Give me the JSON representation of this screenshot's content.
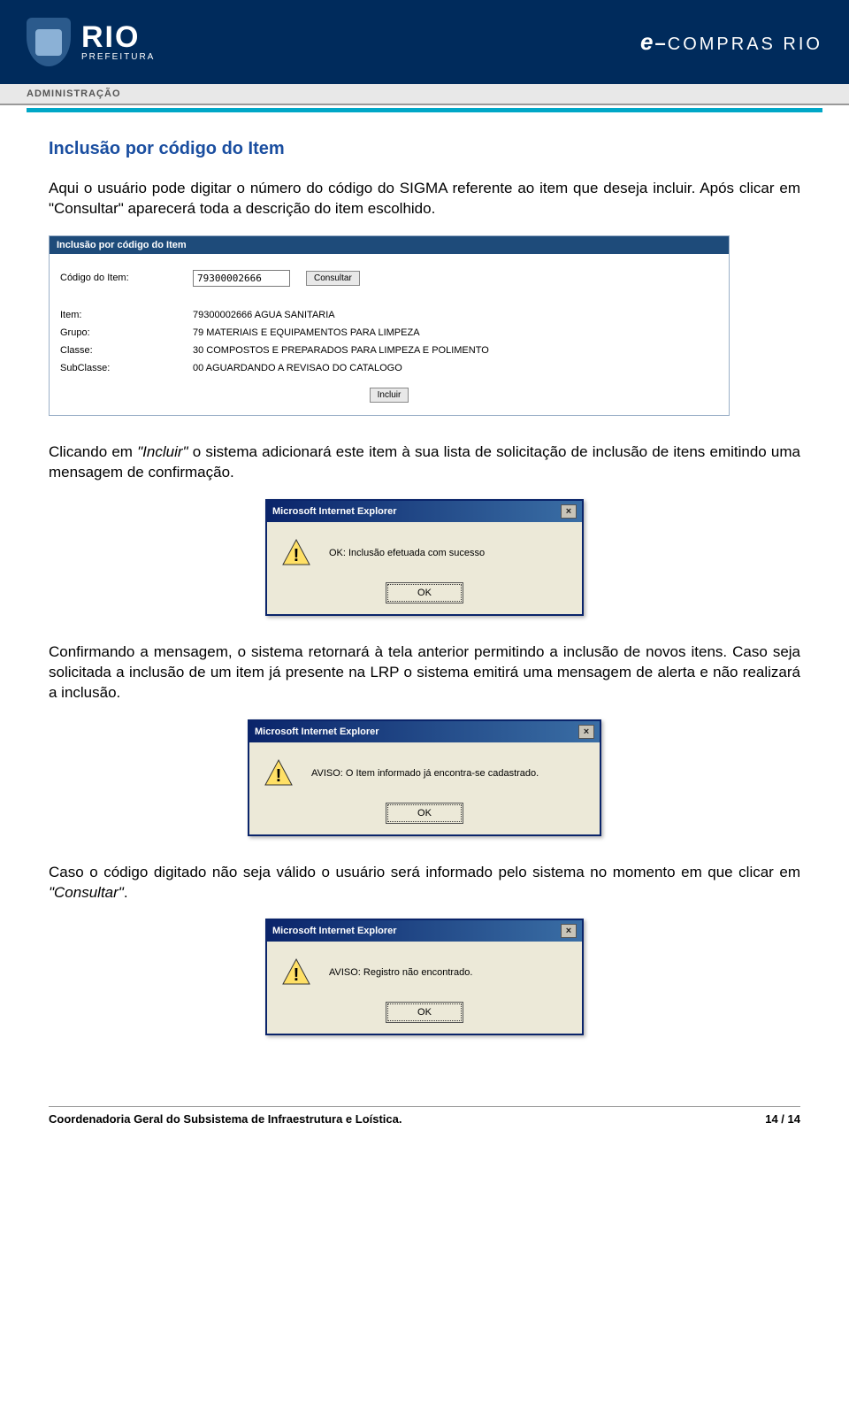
{
  "header": {
    "logo_main": "RIO",
    "logo_sub": "PREFEITURA",
    "right_e": "e",
    "right_dash": "–",
    "right_rest": "COMPRAS RIO"
  },
  "admin_bar": "ADMINISTRAÇÃO",
  "section_title": "Inclusão por código do Item",
  "para1": "Aqui o usuário pode digitar o número do código do SIGMA referente ao item que deseja incluir. Após clicar em \"Consultar\" aparecerá toda a descrição do item escolhido.",
  "form": {
    "title": "Inclusão por código do Item",
    "label_codigo": "Código do Item:",
    "codigo_value": "79300002666",
    "btn_consultar": "Consultar",
    "label_item": "Item:",
    "val_item": "79300002666 AGUA SANITARIA",
    "label_grupo": "Grupo:",
    "val_grupo": "79 MATERIAIS E EQUIPAMENTOS PARA LIMPEZA",
    "label_classe": "Classe:",
    "val_classe": "30 COMPOSTOS E PREPARADOS PARA LIMPEZA E POLIMENTO",
    "label_subclasse": "SubClasse:",
    "val_subclasse": "00 AGUARDANDO A REVISAO DO CATALOGO",
    "btn_incluir": "Incluir"
  },
  "para2_a": "Clicando em ",
  "para2_incluir": "\"Incluir\"",
  "para2_b": " o sistema adicionará este item à sua lista de solicitação de inclusão de itens emitindo uma mensagem de confirmação.",
  "dialog1": {
    "title": "Microsoft Internet Explorer",
    "msg": "OK: Inclusão efetuada com sucesso",
    "ok": "OK"
  },
  "para3": "Confirmando a mensagem, o sistema retornará à tela anterior permitindo a inclusão de novos itens. Caso seja solicitada a inclusão de um item já presente na LRP o sistema emitirá uma mensagem de alerta e não realizará a inclusão.",
  "dialog2": {
    "title": "Microsoft Internet Explorer",
    "msg": "AVISO: O Item informado já encontra-se cadastrado.",
    "ok": "OK"
  },
  "para4_a": "Caso o código digitado não seja válido o usuário será informado pelo sistema no momento em que clicar em ",
  "para4_consultar": "\"Consultar\"",
  "para4_b": ".",
  "dialog3": {
    "title": "Microsoft Internet Explorer",
    "msg": "AVISO: Registro não encontrado.",
    "ok": "OK"
  },
  "footer": {
    "left": "Coordenadoria Geral do Subsistema de Infraestrutura e Loística.",
    "right": "14 / 14"
  }
}
